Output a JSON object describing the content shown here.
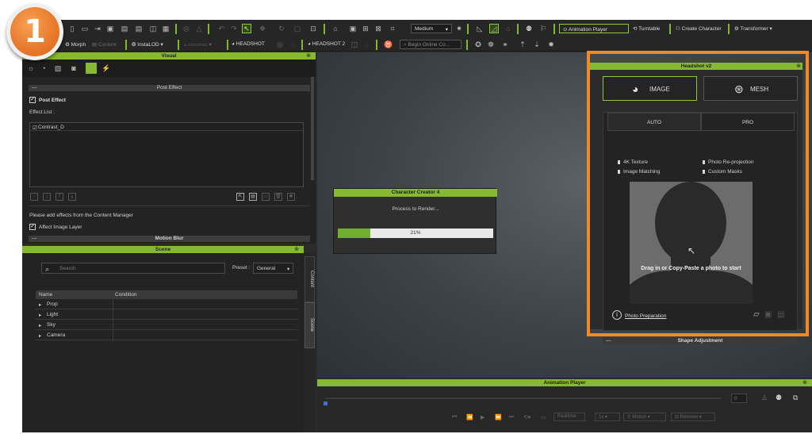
{
  "step_badge": "1",
  "toolbar": {
    "quality_select": "Medium",
    "morph_label": "Morph",
    "content_label": "Content",
    "instalod_label": "InstaLOD",
    "headshot_label": "HEADSHOT",
    "headshot2_label": "HEADSHOT 2",
    "search_placeholder": "Begin Online Co...",
    "animation_player_btn": "Animation Player",
    "turntable_btn": "Turntable",
    "create_character_btn": "Create Character",
    "transformer_btn": "Transformer"
  },
  "visual_panel": {
    "title": "Visual",
    "post_effect_section": "Post Effect",
    "post_effect_checkbox": "Post Effect",
    "effect_list_label": "Effect List :",
    "effect_items": [
      "Contrast_D"
    ],
    "hint_text": "Please add effects from the Content Manager",
    "affect_image_layer": "Affect Image Layer",
    "motion_blur_section": "Motion Blur"
  },
  "scene_panel": {
    "title": "Scene",
    "search_placeholder": "Search",
    "preset_label": "Preset :",
    "preset_value": "General",
    "col_name": "Name",
    "col_condition": "Condition",
    "rows": [
      "Prop",
      "Light",
      "Sky",
      "Camera"
    ],
    "tab_content": "Content",
    "tab_scene": "Scene"
  },
  "render_dialog": {
    "title": "Character Creator 4",
    "message": "Process to Render...",
    "progress_text": "21%",
    "progress_value": 0.21
  },
  "headshot": {
    "title": "Headshot v2",
    "image_btn": "IMAGE",
    "mesh_btn": "MESH",
    "tab_auto": "AUTO",
    "tab_pro": "PRO",
    "features": [
      "4K Texture",
      "Photo Re-projection",
      "Image Matching",
      "Custom Masks"
    ],
    "drop_text": "Drag in or Copy-Paste a photo to start",
    "photo_prep_link": "Photo Preparation",
    "shape_adjustment": "Shape Adjustment"
  },
  "animation_player": {
    "title": "Animation Player",
    "frame_value": "0",
    "realtime_label": "Realtime",
    "speed_value": "1x",
    "motion_label": "Motion",
    "remove_label": "Remove"
  },
  "colors": {
    "accent_green": "#86b92f",
    "highlight_orange": "#f28a24"
  }
}
